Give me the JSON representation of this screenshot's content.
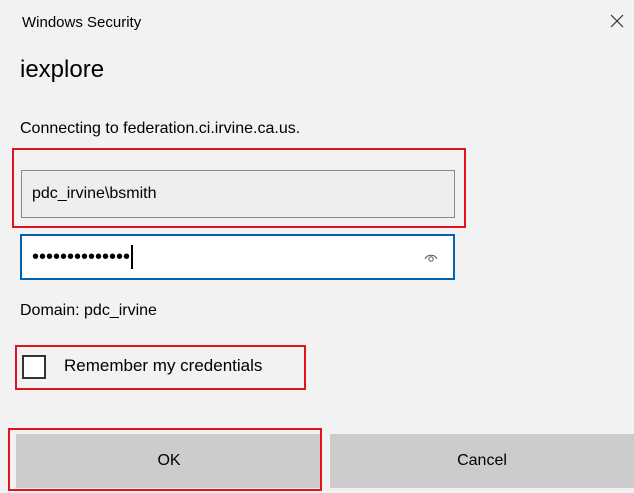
{
  "window": {
    "title": "Windows Security",
    "close_icon": "close-icon"
  },
  "app": {
    "name": "iexplore"
  },
  "message": {
    "connecting": "Connecting to federation.ci.irvine.ca.us."
  },
  "username": {
    "value": "pdc_irvine\\bsmith"
  },
  "password": {
    "masked_value": "••••••••••••••",
    "reveal_icon": "eye-icon"
  },
  "domain": {
    "text": "Domain: pdc_irvine"
  },
  "remember": {
    "label": "Remember my credentials",
    "checked": false
  },
  "buttons": {
    "ok": "OK",
    "cancel": "Cancel"
  },
  "colors": {
    "highlight": "#e0141e",
    "focus_border": "#0063b1",
    "dialog_bg": "#f2f2f2",
    "button_bg": "#cccccc"
  }
}
